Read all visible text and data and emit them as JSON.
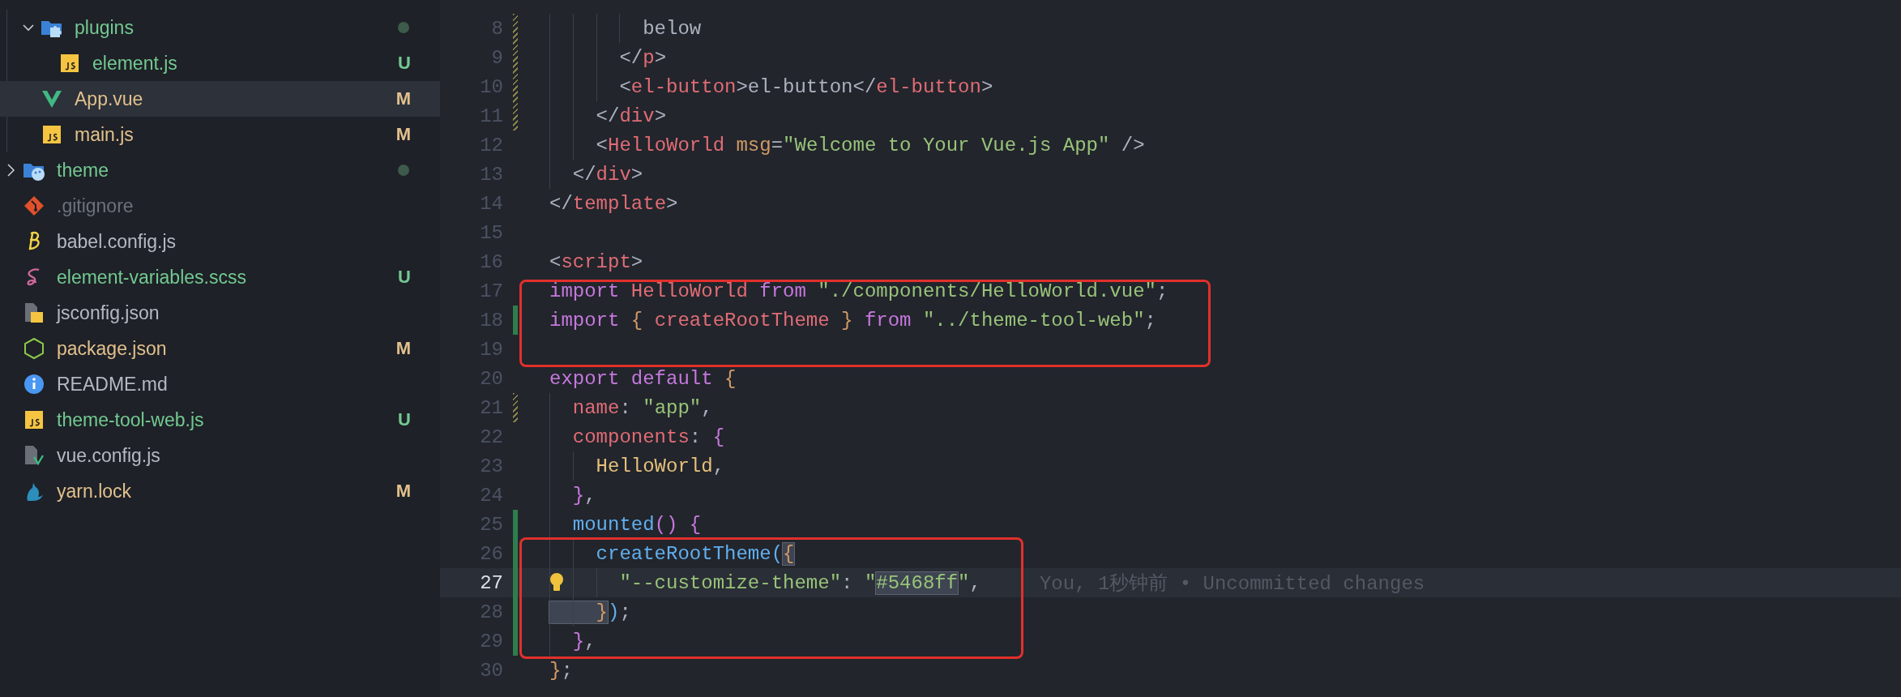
{
  "explorer": {
    "items": [
      {
        "expanded": true,
        "children": [
          {
            "label": "plugins",
            "kind": "folder-plugin",
            "color": "#73c991",
            "dot": true,
            "selected": false,
            "expanded": true,
            "children": [
              {
                "label": "element.js",
                "kind": "js",
                "color": "#73c991",
                "badge": "U",
                "selected": false
              }
            ]
          },
          {
            "label": "App.vue",
            "kind": "vue",
            "color": "#e2c08d",
            "badge": "M",
            "selected": true
          },
          {
            "label": "main.js",
            "kind": "js",
            "color": "#e2c08d",
            "badge": "M",
            "selected": false
          }
        ]
      },
      {
        "label": "theme",
        "kind": "folder-theme",
        "color": "#73c991",
        "dot": true,
        "selected": false,
        "expanded": false
      },
      {
        "label": ".gitignore",
        "kind": "git",
        "color": "#6b717d",
        "selected": false
      },
      {
        "label": "babel.config.js",
        "kind": "babel",
        "color": "#b4b9c3",
        "selected": false
      },
      {
        "label": "element-variables.scss",
        "kind": "sass",
        "color": "#73c991",
        "badge": "U",
        "selected": false
      },
      {
        "label": "jsconfig.json",
        "kind": "json-js",
        "color": "#b4b9c3",
        "selected": false
      },
      {
        "label": "package.json",
        "kind": "node",
        "color": "#e2c08d",
        "badge": "M",
        "selected": false
      },
      {
        "label": "README.md",
        "kind": "info",
        "color": "#b4b9c3",
        "selected": false
      },
      {
        "label": "theme-tool-web.js",
        "kind": "js",
        "color": "#73c991",
        "badge": "U",
        "selected": false
      },
      {
        "label": "vue.config.js",
        "kind": "vue-config",
        "color": "#b4b9c3",
        "selected": false
      },
      {
        "label": "yarn.lock",
        "kind": "yarn",
        "color": "#e2c08d",
        "badge": "M",
        "selected": false
      }
    ]
  },
  "editor": {
    "blocks": [
      {
        "boxed": false,
        "lines": [
          {
            "number": "8",
            "kind": "modified",
            "tokens": [
              {
                "kind": "text",
                "text": "        below"
              }
            ]
          },
          {
            "number": "9",
            "kind": "modified",
            "tokens": [
              {
                "kind": "punct",
                "text": "      </"
              },
              {
                "kind": "tag",
                "text": "p"
              },
              {
                "kind": "punct",
                "text": ">"
              }
            ]
          },
          {
            "number": "10",
            "kind": "modified",
            "tokens": [
              {
                "kind": "punct",
                "text": "      <"
              },
              {
                "kind": "tag",
                "text": "el-button"
              },
              {
                "kind": "punct",
                "text": ">"
              },
              {
                "kind": "text",
                "text": "el-button"
              },
              {
                "kind": "punct",
                "text": "</"
              },
              {
                "kind": "tag",
                "text": "el-button"
              },
              {
                "kind": "punct",
                "text": ">"
              }
            ]
          },
          {
            "number": "11",
            "kind": "modified",
            "tokens": [
              {
                "kind": "punct",
                "text": "    </"
              },
              {
                "kind": "tag",
                "text": "div"
              },
              {
                "kind": "punct",
                "text": ">"
              }
            ]
          },
          {
            "number": "12",
            "kind": "unchanged",
            "tokens": [
              {
                "kind": "punct",
                "text": "    <"
              },
              {
                "kind": "tag",
                "text": "HelloWorld "
              },
              {
                "kind": "attr",
                "text": "msg"
              },
              {
                "kind": "punct",
                "text": "="
              },
              {
                "kind": "string",
                "text": "\"Welcome to Your Vue.js App\""
              },
              {
                "kind": "punct",
                "text": " />"
              }
            ]
          },
          {
            "number": "13",
            "kind": "unchanged",
            "tokens": [
              {
                "kind": "punct",
                "text": "  </"
              },
              {
                "kind": "tag",
                "text": "div"
              },
              {
                "kind": "punct",
                "text": ">"
              }
            ]
          },
          {
            "number": "14",
            "kind": "unchanged",
            "tokens": [
              {
                "kind": "punct",
                "text": "</"
              },
              {
                "kind": "tag",
                "text": "template"
              },
              {
                "kind": "punct",
                "text": ">"
              }
            ]
          },
          {
            "number": "15",
            "kind": "unchanged"
          },
          {
            "number": "16",
            "kind": "unchanged",
            "tokens": [
              {
                "kind": "punct",
                "text": "<"
              },
              {
                "kind": "tag",
                "text": "script"
              },
              {
                "kind": "punct",
                "text": ">"
              }
            ]
          }
        ]
      },
      {
        "boxed": true,
        "lines": [
          {
            "number": "17",
            "kind": "unchanged",
            "tokens": [
              {
                "kind": "keyword",
                "text": "import "
              },
              {
                "kind": "ident",
                "text": "HelloWorld "
              },
              {
                "kind": "keyword",
                "text": "from "
              },
              {
                "kind": "string",
                "text": "\"./components/HelloWorld.vue\""
              },
              {
                "kind": "text",
                "text": ";"
              }
            ]
          },
          {
            "number": "18",
            "kind": "added",
            "tokens": [
              {
                "kind": "keyword",
                "text": "import "
              },
              {
                "kind": "brace",
                "text": "{ "
              },
              {
                "kind": "ident",
                "text": "createRootTheme "
              },
              {
                "kind": "brace",
                "text": "} "
              },
              {
                "kind": "keyword",
                "text": "from "
              },
              {
                "kind": "string",
                "text": "\"../theme-tool-web\""
              },
              {
                "kind": "text",
                "text": ";"
              }
            ]
          },
          {
            "number": "19",
            "kind": "unchanged"
          }
        ]
      },
      {
        "boxed": false,
        "lines": [
          {
            "number": "20",
            "kind": "unchanged",
            "tokens": [
              {
                "kind": "keyword",
                "text": "export default "
              },
              {
                "kind": "brace",
                "text": "{"
              }
            ]
          },
          {
            "number": "21",
            "kind": "modified",
            "tokens": [
              {
                "kind": "prop",
                "text": "  name"
              },
              {
                "kind": "text",
                "text": ": "
              },
              {
                "kind": "string",
                "text": "\"app\""
              },
              {
                "kind": "text",
                "text": ","
              }
            ]
          },
          {
            "number": "22",
            "kind": "unchanged",
            "tokens": [
              {
                "kind": "prop",
                "text": "  components"
              },
              {
                "kind": "text",
                "text": ": "
              },
              {
                "kind": "purple",
                "text": "{"
              }
            ]
          },
          {
            "number": "23",
            "kind": "unchanged",
            "tokens": [
              {
                "kind": "class",
                "text": "    HelloWorld"
              },
              {
                "kind": "text",
                "text": ","
              }
            ]
          },
          {
            "number": "24",
            "kind": "unchanged",
            "tokens": [
              {
                "kind": "purple",
                "text": "  }"
              },
              {
                "kind": "text",
                "text": ","
              }
            ]
          },
          {
            "number": "25",
            "kind": "added",
            "tokens": [
              {
                "kind": "func",
                "text": "  mounted"
              },
              {
                "kind": "purple",
                "text": "() {"
              }
            ]
          }
        ]
      },
      {
        "boxed": true,
        "lines": [
          {
            "number": "26",
            "kind": "added",
            "tokens": [
              {
                "kind": "func",
                "text": "    createRootTheme("
              },
              {
                "kind": "brace",
                "text": "{",
                "highlighted": true
              }
            ]
          },
          {
            "number": "27",
            "kind": "added",
            "current": true,
            "lightbulb": true,
            "blame": "You, 1秒钟前 • Uncommitted changes",
            "tokens": [
              {
                "kind": "string",
                "text": "      \"--customize-theme\""
              },
              {
                "kind": "text",
                "text": ": "
              },
              {
                "kind": "string",
                "text": "\""
              },
              {
                "kind": "string",
                "text": "#5468ff",
                "highlighted": true
              },
              {
                "kind": "string",
                "text": "\""
              },
              {
                "kind": "text",
                "text": ","
              }
            ]
          },
          {
            "number": "28",
            "kind": "added",
            "tokens": [
              {
                "kind": "brace",
                "text": "    }",
                "highlighted": true
              },
              {
                "kind": "func",
                "text": ")"
              },
              {
                "kind": "text",
                "text": ";"
              }
            ]
          },
          {
            "number": "29",
            "kind": "added",
            "tokens": [
              {
                "kind": "purple",
                "text": "  }"
              },
              {
                "kind": "text",
                "text": ","
              }
            ]
          }
        ]
      },
      {
        "boxed": false,
        "lines": [
          {
            "number": "30",
            "kind": "unchanged",
            "tokens": [
              {
                "kind": "brace",
                "text": "}"
              },
              {
                "kind": "text",
                "text": ";"
              }
            ]
          }
        ]
      }
    ]
  }
}
